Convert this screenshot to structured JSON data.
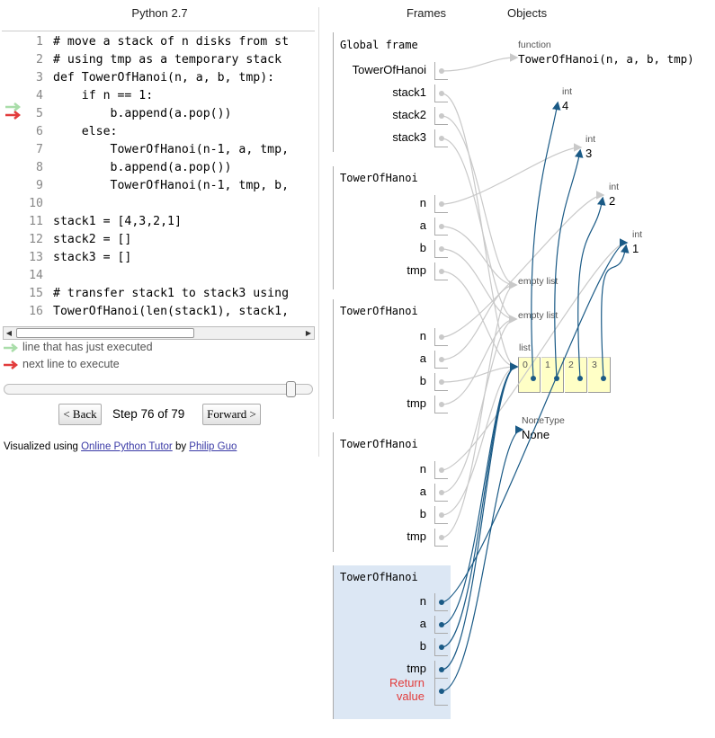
{
  "app": {
    "language": "Python 2.7",
    "frames_header": "Frames",
    "objects_header": "Objects"
  },
  "code": {
    "lines": [
      {
        "num": "1",
        "text": "# move a stack of n disks from st"
      },
      {
        "num": "2",
        "text": "# using tmp as a temporary stack"
      },
      {
        "num": "3",
        "text": "def TowerOfHanoi(n, a, b, tmp):"
      },
      {
        "num": "4",
        "text": "    if n == 1:"
      },
      {
        "num": "5",
        "text": "        b.append(a.pop())"
      },
      {
        "num": "6",
        "text": "    else:"
      },
      {
        "num": "7",
        "text": "        TowerOfHanoi(n-1, a, tmp,"
      },
      {
        "num": "8",
        "text": "        b.append(a.pop())"
      },
      {
        "num": "9",
        "text": "        TowerOfHanoi(n-1, tmp, b,"
      },
      {
        "num": "10",
        "text": ""
      },
      {
        "num": "11",
        "text": "stack1 = [4,3,2,1]"
      },
      {
        "num": "12",
        "text": "stack2 = []"
      },
      {
        "num": "13",
        "text": "stack3 = []"
      },
      {
        "num": "14",
        "text": ""
      },
      {
        "num": "15",
        "text": "# transfer stack1 to stack3 using"
      },
      {
        "num": "16",
        "text": "TowerOfHanoi(len(stack1), stack1,"
      }
    ],
    "just_executed_line": "5",
    "next_line": "5"
  },
  "legend": {
    "executed": "line that has just executed",
    "next": "next line to execute"
  },
  "controls": {
    "back": "< Back",
    "forward": "Forward >",
    "step": "Step 76 of 79",
    "progress": 0.95
  },
  "footer": {
    "prefix": "Visualized using ",
    "tool_link": "Online Python Tutor",
    "by": " by ",
    "author_link": "Philip Guo"
  },
  "frames": [
    {
      "title": "Global frame",
      "vars": [
        "TowerOfHanoi",
        "stack1",
        "stack2",
        "stack3"
      ]
    },
    {
      "title": "TowerOfHanoi",
      "vars": [
        "n",
        "a",
        "b",
        "tmp"
      ]
    },
    {
      "title": "TowerOfHanoi",
      "vars": [
        "n",
        "a",
        "b",
        "tmp"
      ]
    },
    {
      "title": "TowerOfHanoi",
      "vars": [
        "n",
        "a",
        "b",
        "tmp"
      ]
    },
    {
      "title": "TowerOfHanoi",
      "vars": [
        "n",
        "a",
        "b",
        "tmp"
      ],
      "return_label": "Return value",
      "highlighted": true
    }
  ],
  "objects": {
    "function": {
      "type": "function",
      "value": "TowerOfHanoi(n, a, b, tmp)"
    },
    "ints": [
      {
        "type": "int",
        "value": "4"
      },
      {
        "type": "int",
        "value": "3"
      },
      {
        "type": "int",
        "value": "2"
      },
      {
        "type": "int",
        "value": "1"
      }
    ],
    "empty_list_1": "empty list",
    "empty_list_2": "empty list",
    "list": {
      "type": "list",
      "indices": [
        "0",
        "1",
        "2",
        "3"
      ]
    },
    "none": {
      "type": "NoneType",
      "value": "None"
    }
  },
  "colors": {
    "current_frame_bg": "#dce7f4",
    "return_value": "#e23c3c",
    "pointer_active": "#1a5a86",
    "pointer_inactive": "#c9c9c9",
    "list_cell": "#ffffc6",
    "executed_arrow": "#a9dda9",
    "next_arrow": "#e23c3c"
  }
}
